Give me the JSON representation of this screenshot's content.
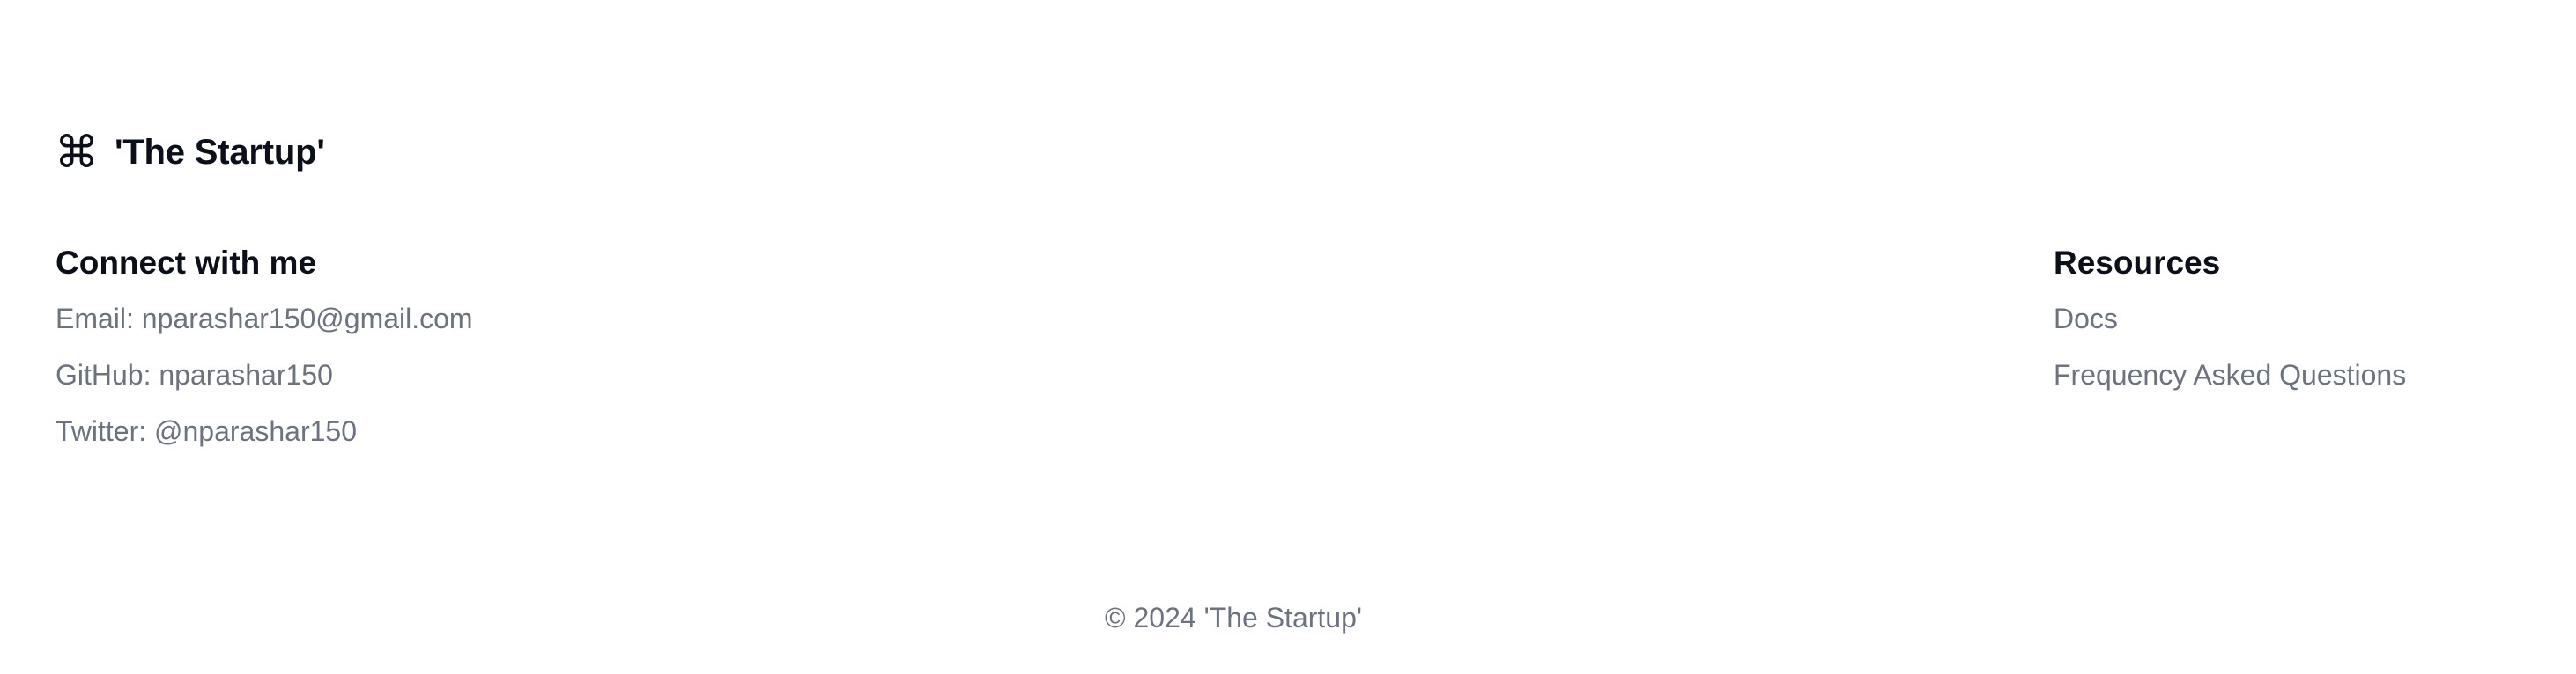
{
  "brand": {
    "icon_glyph": "⌘",
    "icon_name": "command-icon",
    "name": "'The Startup'"
  },
  "connect": {
    "heading": "Connect with me",
    "items": [
      {
        "label": "Email: nparashar150@gmail.com"
      },
      {
        "label": "GitHub: nparashar150"
      },
      {
        "label": "Twitter: @nparashar150"
      }
    ]
  },
  "resources": {
    "heading": "Resources",
    "items": [
      {
        "label": "Docs"
      },
      {
        "label": "Frequency Asked Questions"
      }
    ]
  },
  "copyright": "© 2024 'The Startup'",
  "colors": {
    "heading": "#0b0f1a",
    "muted_text": "#6b7280",
    "background": "#ffffff"
  }
}
